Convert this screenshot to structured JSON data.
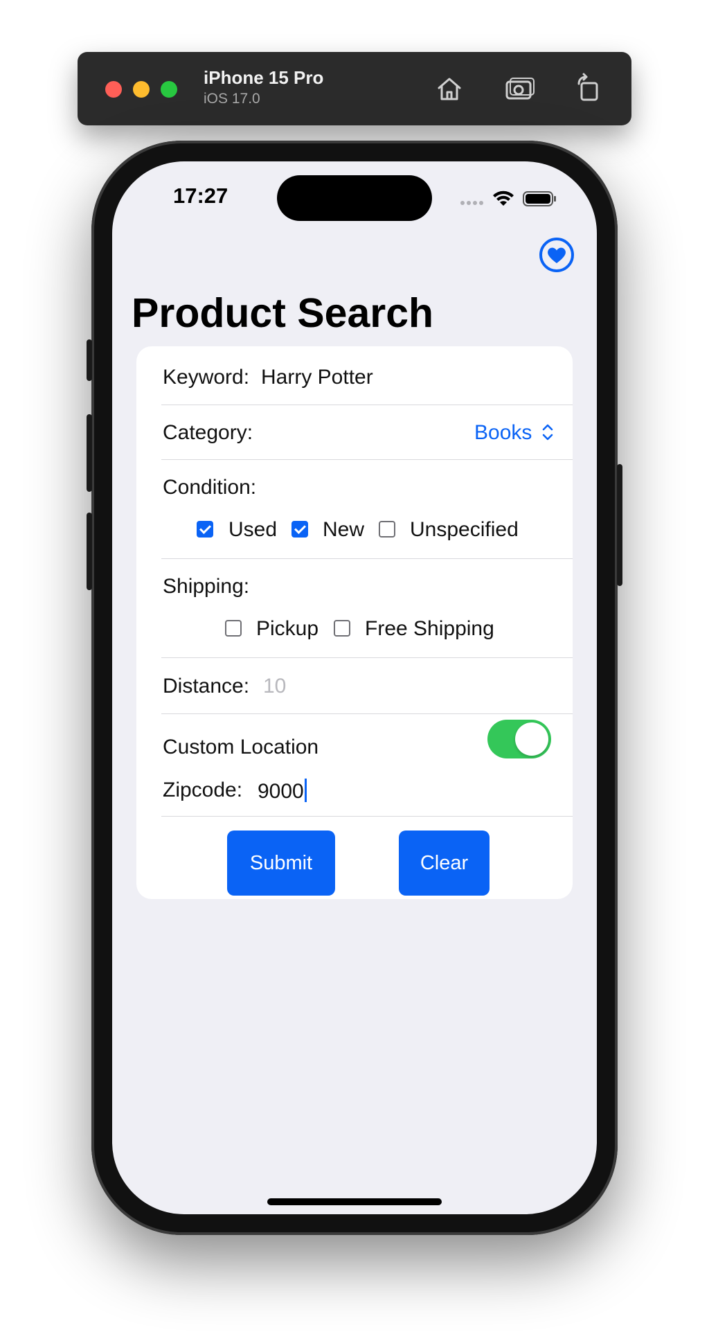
{
  "simulator": {
    "device_name": "iPhone 15 Pro",
    "os_version": "iOS 17.0",
    "icons": [
      "home-icon",
      "screenshot-icon",
      "rotate-icon"
    ]
  },
  "status_bar": {
    "time": "17:27",
    "icons": [
      "cellular-signal-icon",
      "wifi-icon",
      "battery-icon"
    ]
  },
  "nav": {
    "favorite_icon": "heart-circle-icon"
  },
  "page": {
    "title": "Product Search"
  },
  "form": {
    "keyword": {
      "label": "Keyword:",
      "value": "Harry Potter"
    },
    "category": {
      "label": "Category:",
      "selected": "Books",
      "icon": "chevron-up-down-icon"
    },
    "condition": {
      "label": "Condition:",
      "options": [
        {
          "label": "Used",
          "checked": true
        },
        {
          "label": "New",
          "checked": true
        },
        {
          "label": "Unspecified",
          "checked": false
        }
      ]
    },
    "shipping": {
      "label": "Shipping:",
      "options": [
        {
          "label": "Pickup",
          "checked": false
        },
        {
          "label": "Free Shipping",
          "checked": false
        }
      ]
    },
    "distance": {
      "label": "Distance:",
      "placeholder": "10",
      "value": ""
    },
    "custom_location": {
      "label": "Custom Location",
      "enabled": true
    },
    "zipcode": {
      "label": "Zipcode:",
      "value": "9000"
    },
    "buttons": {
      "submit": "Submit",
      "clear": "Clear"
    }
  },
  "colors": {
    "accent": "#0a63f5",
    "toggle_on": "#34c759",
    "background": "#efeff5"
  }
}
